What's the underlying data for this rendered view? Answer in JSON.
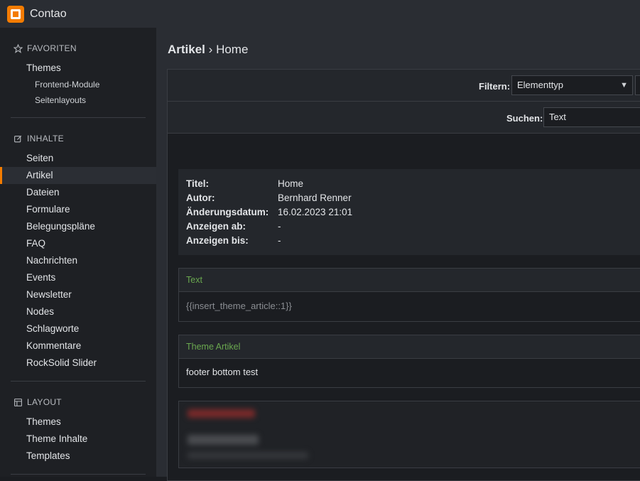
{
  "app": {
    "name": "Contao",
    "logo_icon": "contao-logo-icon",
    "accent": "#f47c00"
  },
  "sidebar": {
    "groups": [
      {
        "title": "FAVORITEN",
        "icon": "star-icon",
        "items": [
          {
            "label": "Themes",
            "sub": [
              "Frontend-Module",
              "Seitenlayouts"
            ]
          }
        ]
      },
      {
        "title": "INHALTE",
        "icon": "edit-icon",
        "items": [
          {
            "label": "Seiten"
          },
          {
            "label": "Artikel",
            "active": true
          },
          {
            "label": "Dateien"
          },
          {
            "label": "Formulare"
          },
          {
            "label": "Belegungspläne"
          },
          {
            "label": "FAQ"
          },
          {
            "label": "Nachrichten"
          },
          {
            "label": "Events"
          },
          {
            "label": "Newsletter"
          },
          {
            "label": "Nodes"
          },
          {
            "label": "Schlagworte"
          },
          {
            "label": "Kommentare"
          },
          {
            "label": "RockSolid Slider"
          }
        ]
      },
      {
        "title": "LAYOUT",
        "icon": "layout-icon",
        "items": [
          {
            "label": "Themes"
          },
          {
            "label": "Theme Inhalte"
          },
          {
            "label": "Templates"
          }
        ]
      }
    ]
  },
  "breadcrumb": {
    "section": "Artikel",
    "separator": "›",
    "page": "Home"
  },
  "filter": {
    "label": "Filtern:",
    "value": "Elementtyp"
  },
  "search": {
    "label": "Suchen:",
    "value": "Text"
  },
  "article_info": [
    {
      "key": "Titel:",
      "value": "Home"
    },
    {
      "key": "Autor:",
      "value": "Bernhard Renner"
    },
    {
      "key": "Änderungsdatum:",
      "value": "16.02.2023 21:01"
    },
    {
      "key": "Anzeigen ab:",
      "value": "-"
    },
    {
      "key": "Anzeigen bis:",
      "value": "-"
    }
  ],
  "elements": [
    {
      "type": "Text",
      "body": "{{insert_theme_article::1}}"
    },
    {
      "type": "Theme Artikel",
      "body": "footer bottom test"
    }
  ]
}
